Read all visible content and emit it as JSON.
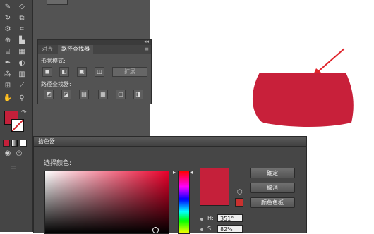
{
  "pathfinder_panel": {
    "tabs": [
      "对齐",
      "路径查找器"
    ],
    "menu_icon": "panel-menu-icon",
    "collapse_icon": "double-arrow-icon",
    "shape_modes_label": "形状模式:",
    "pathfinders_label": "路径查找器:",
    "expand_label": "扩展"
  },
  "color_picker": {
    "title": "拾色器",
    "choose_label": "选择颜色:",
    "ok_label": "确定",
    "cancel_label": "取消",
    "swatches_label": "颜色色板",
    "hue_label": "H:",
    "hue_value": "351°",
    "sat_label": "S:",
    "sat_value": "82%"
  },
  "colors": {
    "fill": "#c5203a",
    "shape": "#c8203a",
    "annotation_arrow": "#e0252c"
  }
}
